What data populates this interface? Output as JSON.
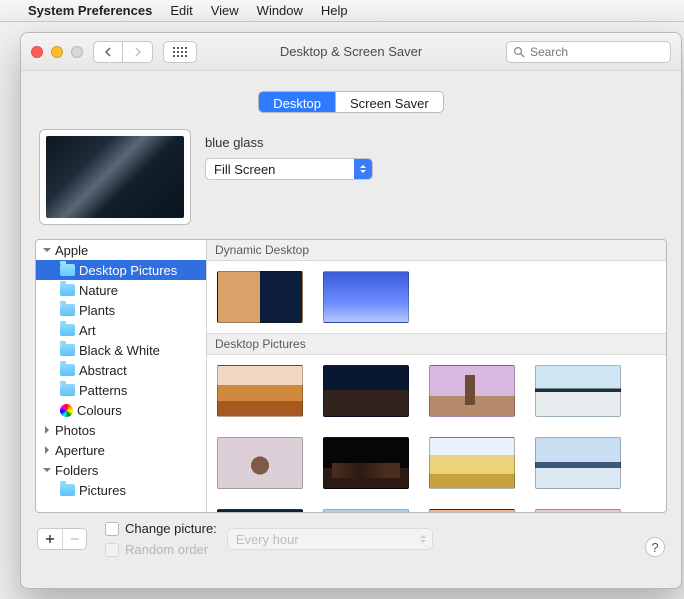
{
  "menubar": {
    "app_name": "System Preferences",
    "items": [
      "Edit",
      "View",
      "Window",
      "Help"
    ]
  },
  "window": {
    "title": "Desktop & Screen Saver",
    "search_placeholder": "Search"
  },
  "tabs": {
    "desktop": "Desktop",
    "screensaver": "Screen Saver",
    "active": "desktop"
  },
  "wallpaper": {
    "name": "blue glass",
    "fit_mode": "Fill Screen"
  },
  "tree": [
    {
      "label": "Apple",
      "depth": 0,
      "disclose": "open",
      "icon": "none"
    },
    {
      "label": "Desktop Pictures",
      "depth": 1,
      "icon": "folder",
      "selected": true
    },
    {
      "label": "Nature",
      "depth": 1,
      "icon": "folder"
    },
    {
      "label": "Plants",
      "depth": 1,
      "icon": "folder"
    },
    {
      "label": "Art",
      "depth": 1,
      "icon": "folder"
    },
    {
      "label": "Black & White",
      "depth": 1,
      "icon": "folder"
    },
    {
      "label": "Abstract",
      "depth": 1,
      "icon": "folder"
    },
    {
      "label": "Patterns",
      "depth": 1,
      "icon": "folder"
    },
    {
      "label": "Colours",
      "depth": 1,
      "icon": "color"
    },
    {
      "label": "Photos",
      "depth": 0,
      "disclose": "closed",
      "icon": "none"
    },
    {
      "label": "Aperture",
      "depth": 0,
      "disclose": "closed",
      "icon": "none"
    },
    {
      "label": "Folders",
      "depth": 0,
      "disclose": "open",
      "icon": "none"
    },
    {
      "label": "Pictures",
      "depth": 1,
      "icon": "folder"
    }
  ],
  "gallery": {
    "sections": [
      {
        "title": "Dynamic Desktop",
        "thumbs": [
          "t-dune-split",
          "t-blue-grad"
        ]
      },
      {
        "title": "Desktop Pictures",
        "thumbs": [
          "t-dune-light",
          "t-dune-dark",
          "t-pillar",
          "t-flat",
          "t-rock",
          "t-city",
          "t-yellow",
          "t-wave",
          "t-darkblue",
          "t-sky1",
          "t-sunset",
          "t-pink"
        ]
      }
    ]
  },
  "footer": {
    "change_label": "Change picture:",
    "random_label": "Random order",
    "interval": "Every hour",
    "change_checked": false,
    "random_enabled": false,
    "add_enabled": true,
    "remove_enabled": false
  }
}
